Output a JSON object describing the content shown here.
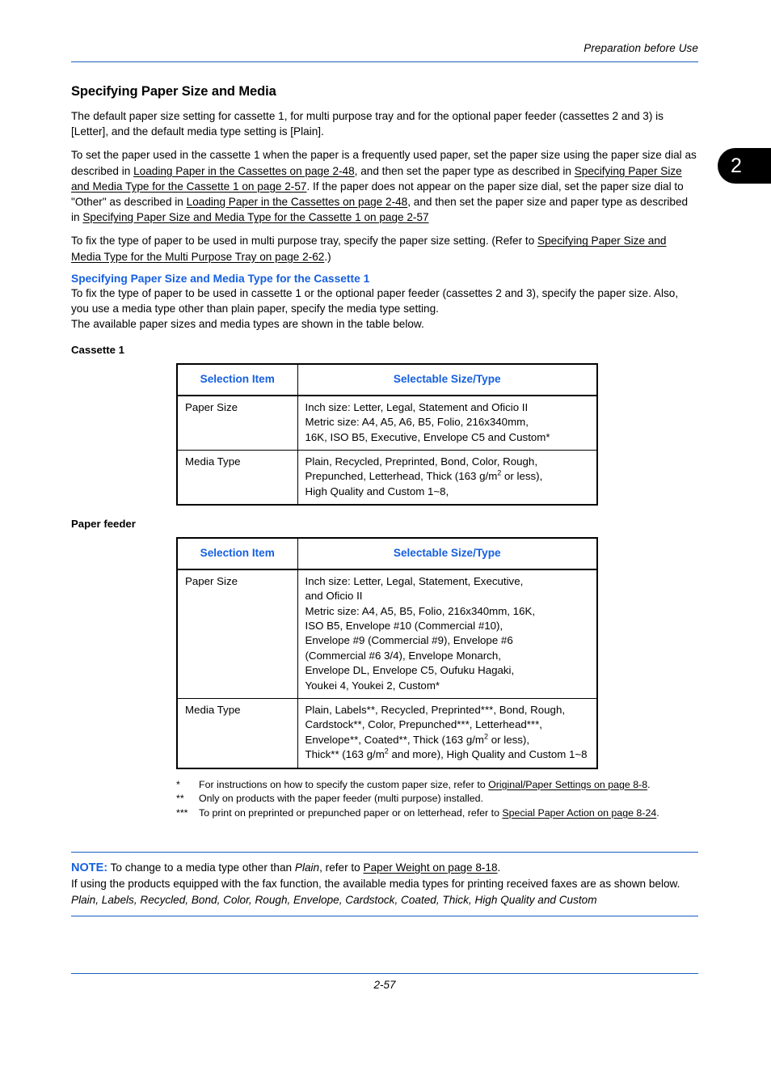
{
  "header": {
    "running_title": "Preparation before Use",
    "chapter_tab": "2",
    "rule_color": "#1a5fbf"
  },
  "accent_color": "#1560e0",
  "section": {
    "title": "Specifying Paper Size and Media",
    "paragraph_1": "The default paper size setting for cassette 1, for multi purpose tray and for the optional paper feeder (cassettes 2 and 3) is [Letter], and the default media type setting is [Plain].",
    "paragraph_2_a": "To set the paper used in the cassette 1 when the paper is a frequently used paper, set the paper size using the paper size dial as described in ",
    "paragraph_2_link1": "Loading Paper in the Cassettes on page 2-48",
    "paragraph_2_b": ", and then set the paper type as described in ",
    "paragraph_2_link2": "Specifying Paper Size and Media Type for the Cassette 1 on page 2-57",
    "paragraph_2_c": ". If the paper does not appear on the paper size dial, set the paper size dial to \"Other\" as described in ",
    "paragraph_2_link3": "Loading Paper in the Cassettes on page 2-48",
    "paragraph_2_d": ", and then set the paper size and paper type as described in ",
    "paragraph_2_link4": "Specifying Paper Size and Media Type for the Cassette 1 on page 2-57",
    "paragraph_3_a": "To fix the type of paper to be used in multi purpose tray, specify the paper size setting. (Refer to ",
    "paragraph_3_link": "Specifying Paper Size and Media Type for the Multi Purpose Tray on page 2-62",
    "paragraph_3_b": ".)"
  },
  "subsection": {
    "title": "Specifying Paper Size and Media Type for the Cassette 1",
    "paragraph_1": "To fix the type of paper to be used in cassette 1 or the optional paper feeder (cassettes 2 and 3), specify the paper size. Also, you use a media type other than plain paper, specify the media type setting.",
    "paragraph_2": "The available paper sizes and media types are shown in the table below."
  },
  "table_cassette1": {
    "caption": "Cassette 1",
    "columns": [
      "Selection Item",
      "Selectable Size/Type"
    ],
    "rows": [
      {
        "item": "Paper Size",
        "value_lines": [
          "Inch size: Letter, Legal, Statement and Oficio II",
          "Metric size: A4, A5, A6, B5, Folio, 216x340mm,",
          "16K, ISO B5, Executive, Envelope C5 and Custom*"
        ]
      },
      {
        "item": "Media Type",
        "value_lines": [
          "Plain, Recycled, Preprinted, Bond, Color, Rough,",
          "Prepunched, Letterhead, Thick (163 g/m² or less),",
          "High Quality and Custom 1~8,"
        ]
      }
    ]
  },
  "table_paper_feeder": {
    "caption": "Paper feeder",
    "columns": [
      "Selection Item",
      "Selectable Size/Type"
    ],
    "rows": [
      {
        "item": "Paper Size",
        "value_lines": [
          "Inch size: Letter, Legal, Statement, Executive,",
          "and Oficio II",
          "Metric size: A4, A5, B5, Folio, 216x340mm, 16K,",
          "ISO B5, Envelope #10 (Commercial #10),",
          "Envelope #9 (Commercial #9), Envelope #6",
          "(Commercial #6 3/4), Envelope Monarch,",
          "Envelope DL, Envelope C5, Oufuku Hagaki,",
          "Youkei 4, Youkei 2, Custom*"
        ]
      },
      {
        "item": "Media Type",
        "value_lines": [
          "Plain, Labels**, Recycled, Preprinted***, Bond, Rough,",
          "Cardstock**, Color, Prepunched***, Letterhead***,",
          "Envelope**, Coated**, Thick (163 g/m² or less),",
          "Thick** (163 g/m² and more), High Quality and Custom 1~8"
        ]
      }
    ]
  },
  "footnotes": [
    {
      "mark": "*",
      "text_a": "For instructions on how to specify the custom paper size, refer to ",
      "link": "Original/Paper Settings on page 8-8",
      "text_b": "."
    },
    {
      "mark": "**",
      "text_a": "Only on products with the paper feeder (multi purpose) installed.",
      "link": "",
      "text_b": ""
    },
    {
      "mark": "***",
      "text_a": "To print on preprinted or prepunched paper or on letterhead, refer to ",
      "link": "Special Paper Action on page 8-24",
      "text_b": "."
    }
  ],
  "note": {
    "label": "NOTE:",
    "line1_a": " To change to a media type other than ",
    "line1_italic": "Plain",
    "line1_b": ", refer to ",
    "line1_link": "Paper Weight on page 8-18",
    "line1_c": ".",
    "line2": "If using the products equipped with the fax function, the available media types for printing received faxes are as shown below.",
    "line3": "Plain, Labels, Recycled, Bond, Color, Rough, Envelope, Cardstock, Coated, Thick, High Quality and Custom"
  },
  "footer": {
    "page_number": "2-57"
  }
}
